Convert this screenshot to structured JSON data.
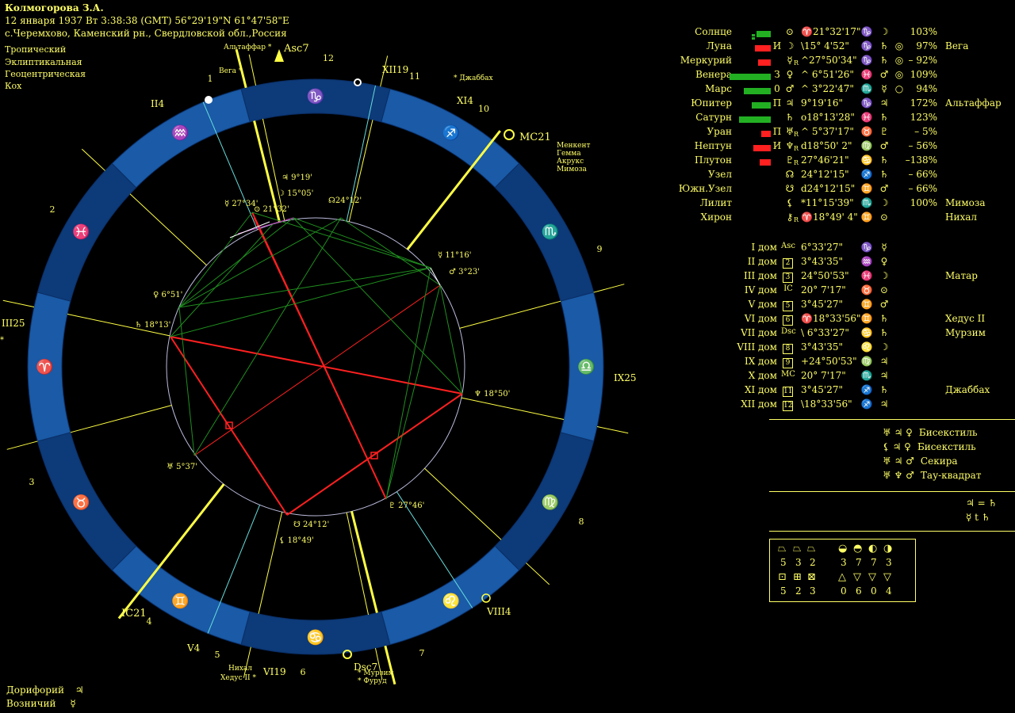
{
  "header": {
    "name": "Колмогорова З.А.",
    "datetime": "12 января 1937  Вт   3:38:38 (GMT) 56°29'19\"N  61°47'58\"E",
    "place": "с.Черемхово, Каменский рн., Свердловской обл.,Россия",
    "settings": [
      "Тропический",
      "Эклиптикальная",
      "Геоцентрическая",
      "Кох"
    ]
  },
  "bottom_left": [
    {
      "label": "Дорифорий",
      "symbol": "♃"
    },
    {
      "label": "Возничий",
      "symbol": "☿"
    }
  ],
  "colors": {
    "background": "#000000",
    "text": "#ffff66",
    "ring": "#1a5aa6",
    "ring_dark": "#0d3a78",
    "aspect_red": "#ff2020",
    "aspect_green": "#1f8f1f",
    "cusp": "#ffff00"
  },
  "zodiac_ring": {
    "signs": [
      "♑",
      "♐",
      "♏",
      "♎",
      "♍",
      "♌",
      "♋",
      "♊",
      "♉",
      "♈",
      "♓",
      "♒"
    ]
  },
  "house_numbers": [
    "1",
    "2",
    "3",
    "4",
    "5",
    "6",
    "7",
    "8",
    "9",
    "10",
    "11",
    "12"
  ],
  "chart_labels": {
    "asc": "Asc",
    "asc_sup": "7",
    "mc": "MC",
    "mc_sup": "21",
    "dsc": "Dsc",
    "dsc_sup": "7",
    "ic": "IC",
    "ic_sup": "21",
    "cusp_labels": [
      {
        "t": "II",
        "s": "4"
      },
      {
        "t": "III",
        "s": "25"
      },
      {
        "t": "XII",
        "s": "19"
      },
      {
        "t": "XI",
        "s": "4"
      },
      {
        "t": "IX",
        "s": "25"
      },
      {
        "t": "VIII",
        "s": "4"
      },
      {
        "t": "VI",
        "s": "19"
      },
      {
        "t": "V",
        "s": "4"
      }
    ],
    "stars": [
      "Альтаффар *",
      "Вега *",
      "* Джаббах",
      "Менкент",
      "Гемма",
      "Акрукс",
      "Мимоза",
      "Нихал",
      "Хедус II *",
      "* Мурзим",
      "* Фуруд"
    ],
    "planet_labels": [
      {
        "t": "♃ 9°19'"
      },
      {
        "t": "☽ 15°05'"
      },
      {
        "t": "☊24°12'"
      },
      {
        "t": "☿ 27°34'"
      },
      {
        "t": "⊙ 21°32'"
      },
      {
        "t": "☿ 11°16'"
      },
      {
        "t": "♂ 3°23'"
      },
      {
        "t": "♀ 6°51'"
      },
      {
        "t": "♄ 18°13'"
      },
      {
        "t": "♆ 18°50'"
      },
      {
        "t": "♅ 5°37'"
      },
      {
        "t": "♇ 27°46'"
      },
      {
        "t": "☋ 24°12'"
      },
      {
        "t": "⚸ 18°49'"
      }
    ]
  },
  "planets": [
    {
      "name": "Солнце",
      "bars": [
        {
          "c": "green",
          "w": 18
        },
        {
          "c": "green",
          "w": 4
        }
      ],
      "mark": "",
      "sym": "⊙",
      "retro": "",
      "pos": "♈21°32'17\"",
      "sign": "♑",
      "ruler": "☽",
      "pct": "103%",
      "star": ""
    },
    {
      "name": "Луна",
      "bars": [
        {
          "c": "red",
          "w": 20
        }
      ],
      "mark": "И",
      "sym": "☽",
      "retro": "",
      "pos": "\\15° 4'52\"",
      "sign": "♑",
      "ruler": "♄",
      "ruler2": "◎",
      "pct": "97%",
      "star": "Вега"
    },
    {
      "name": "Меркурий",
      "bars": [
        {
          "c": "red",
          "w": 16
        }
      ],
      "mark": "",
      "sym": "☿",
      "retro": "R",
      "pos": "^27°50'34\"",
      "sign": "♑",
      "ruler": "♄",
      "ruler2": "◎",
      "pct": "– 92%",
      "star": ""
    },
    {
      "name": "Венера",
      "bars": [
        {
          "c": "green",
          "w": 52
        }
      ],
      "mark": "З",
      "sym": "♀",
      "retro": "",
      "pos": "^ 6°51'26\"",
      "sign": "♓",
      "ruler": "♂",
      "ruler2": "◎",
      "pct": "109%",
      "star": ""
    },
    {
      "name": "Марс",
      "bars": [
        {
          "c": "green",
          "w": 34
        }
      ],
      "mark": "0",
      "sym": "♂",
      "retro": "",
      "pos": "^ 3°22'47\"",
      "sign": "♏",
      "ruler": "☿",
      "ruler2": "○",
      "pct": "94%",
      "star": ""
    },
    {
      "name": "Юпитер",
      "bars": [
        {
          "c": "green",
          "w": 24
        }
      ],
      "mark": "П",
      "sym": "♃",
      "retro": "",
      "pos": "  9°19'16\"",
      "sign": "♑",
      "ruler": "♃",
      "ruler2": "",
      "pct": "172%",
      "star": "Альтаффар"
    },
    {
      "name": "Сатурн",
      "bars": [
        {
          "c": "green",
          "w": 40
        }
      ],
      "mark": "",
      "sym": "♄",
      "retro": "",
      "pos": "o18°13'28\"",
      "sign": "♓",
      "ruler": "♄",
      "ruler2": "",
      "pct": "123%",
      "star": ""
    },
    {
      "name": "Уран",
      "bars": [
        {
          "c": "red",
          "w": 12
        }
      ],
      "mark": "П",
      "sym": "♅",
      "retro": "R",
      "pos": "^ 5°37'17\"",
      "sign": "♉",
      "ruler": "♇",
      "ruler2": "",
      "pct": "– 5%",
      "star": ""
    },
    {
      "name": "Нептун",
      "bars": [
        {
          "c": "red",
          "w": 22
        }
      ],
      "mark": "И",
      "sym": "♆",
      "retro": "R",
      "pos": "d18°50' 2\"",
      "sign": "♍",
      "ruler": "♂",
      "ruler2": "",
      "pct": "– 56%",
      "star": ""
    },
    {
      "name": "Плутон",
      "bars": [
        {
          "c": "red",
          "w": 14
        }
      ],
      "mark": "",
      "sym": "♇",
      "retro": "R",
      "pos": " 27°46'21\"",
      "sign": "♋",
      "ruler": "♄",
      "ruler2": "",
      "pct": "–138%",
      "star": ""
    },
    {
      "name": "Узел",
      "bars": [],
      "mark": "",
      "sym": "☊",
      "retro": "",
      "pos": " 24°12'15\"",
      "sign": "♐",
      "ruler": "♄",
      "ruler2": "",
      "pct": "– 66%",
      "star": ""
    },
    {
      "name": "Южн.Узел",
      "bars": [],
      "mark": "",
      "sym": "☋",
      "retro": "",
      "pos": "d24°12'15\"",
      "sign": "♊",
      "ruler": "♂",
      "ruler2": "",
      "pct": "– 66%",
      "star": ""
    },
    {
      "name": "Лилит",
      "bars": [],
      "mark": "",
      "sym": "⚸",
      "retro": "",
      "pos": "*11°15'39\"",
      "sign": "♏",
      "ruler": "☽",
      "ruler2": "",
      "pct": "100%",
      "star": "Мимоза"
    },
    {
      "name": "Хирон",
      "bars": [],
      "mark": "",
      "sym": "⚷",
      "retro": "R",
      "pos": "♈18°49' 4\"",
      "sign": "♊",
      "ruler": "⊙",
      "ruler2": "",
      "pct": "",
      "star": "Нихал"
    }
  ],
  "houses": [
    {
      "name": "I дом",
      "code": "Asc",
      "pos": " 6°33'27\"",
      "sign": "♑",
      "ruler": "☿",
      "star": ""
    },
    {
      "name": "II дом",
      "code": "2",
      "pos": " 3°43'35\"",
      "sign": "♒",
      "ruler": "♀",
      "star": ""
    },
    {
      "name": "III дом",
      "code": "3",
      "pos": " 24°50'53\"",
      "sign": "♓",
      "ruler": "☽",
      "star": "Матар"
    },
    {
      "name": "IV дом",
      "code": "IC",
      "pos": " 20° 7'17\"",
      "sign": "♉",
      "ruler": "⊙",
      "star": ""
    },
    {
      "name": "V дом",
      "code": "5",
      "pos": " 3°45'27\"",
      "sign": "♊",
      "ruler": "♂",
      "star": ""
    },
    {
      "name": "VI дом",
      "code": "6",
      "pos": "♈18°33'56\"",
      "sign": "♊",
      "ruler": "♄",
      "star": "Хедус II"
    },
    {
      "name": "VII дом",
      "code": "Dsc",
      "pos": "\\ 6°33'27\"",
      "sign": "♋",
      "ruler": "♄",
      "star": "Мурзим"
    },
    {
      "name": "VIII дом",
      "code": "8",
      "pos": " 3°43'35\"",
      "sign": "♌",
      "ruler": "☽",
      "star": ""
    },
    {
      "name": "IX дом",
      "code": "9",
      "pos": "+24°50'53\"",
      "sign": "♍",
      "ruler": "♃",
      "star": ""
    },
    {
      "name": "X дом",
      "code": "MC",
      "pos": " 20° 7'17\"",
      "sign": "♏",
      "ruler": "♃",
      "star": ""
    },
    {
      "name": "XI дом",
      "code": "11",
      "pos": " 3°45'27\"",
      "sign": "♐",
      "ruler": "♄",
      "star": "Джаббах"
    },
    {
      "name": "XII дом",
      "code": "12",
      "pos": "\\18°33'56\"",
      "sign": "♐",
      "ruler": "♃",
      "star": ""
    }
  ],
  "configurations": [
    {
      "symbols": "♅ ♃ ♀",
      "label": "Бисекстиль"
    },
    {
      "symbols": "⚸ ♃ ♀",
      "label": "Бисекстиль"
    },
    {
      "symbols": "♅ ♃ ♂",
      "label": "Секира"
    },
    {
      "symbols": "♅ ♆ ♂",
      "label": "Тау-квадрат"
    }
  ],
  "relations": [
    {
      "text": "♃ = ♄"
    },
    {
      "text": "☿ t ♄"
    }
  ],
  "stats": {
    "row1_icons": [
      "⏢",
      "⏢",
      "⏢",
      "◒",
      "◓",
      "◐",
      "◑"
    ],
    "row1_values": [
      "5",
      "3",
      "2",
      "3",
      "7",
      "7",
      "3"
    ],
    "row2_icons": [
      "⊡",
      "⊞",
      "⊠",
      "△",
      "▽",
      "▽",
      "▽"
    ],
    "row2_values": [
      "5",
      "2",
      "3",
      "0",
      "6",
      "0",
      "4"
    ]
  }
}
